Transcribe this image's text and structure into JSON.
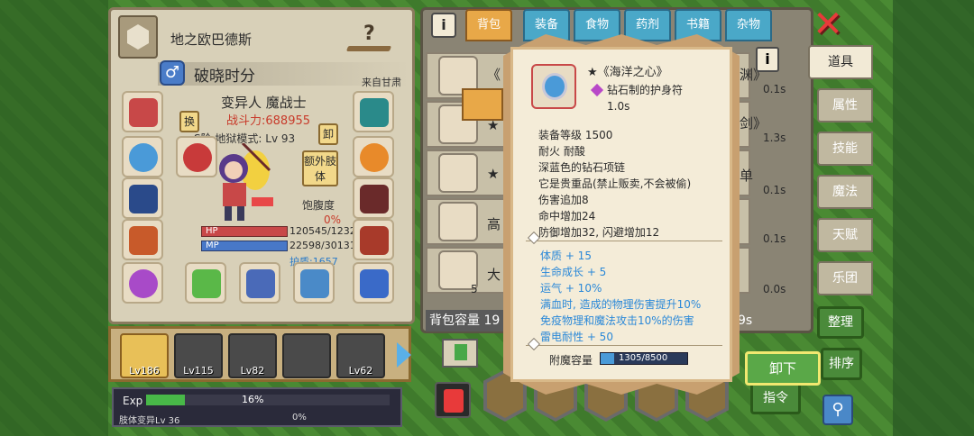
{
  "left": {
    "world_name": "地之欧巴德斯",
    "gender_icon": "♂",
    "player_title": "破晓时分",
    "origin": "来自甘肃",
    "char_class": "变异人 魔战士",
    "combat_power": "战斗力:688955",
    "stage": "S阶 地狱模式: Lv 93",
    "swap_btn": "换",
    "unload_btn": "卸",
    "extra_limb": "额外肢体",
    "hunger_label": "饱腹度",
    "hunger_value": "0%",
    "hp_label": "HP",
    "mp_label": "MP",
    "hp": "120545/1232",
    "mp": "22598/30131",
    "shield": "护盾:1657"
  },
  "party": [
    {
      "level": "Lv186",
      "active": true
    },
    {
      "level": "Lv115",
      "active": false
    },
    {
      "level": "Lv82",
      "active": false
    },
    {
      "level": "",
      "active": false
    },
    {
      "level": "Lv62",
      "active": false
    }
  ],
  "exp": {
    "label": "Exp",
    "percent": "16%",
    "fill_fraction": 0.16,
    "mutation_label": "肢体变异Lv 36",
    "mutation_percent": "0%"
  },
  "bag": {
    "info_icon": "i",
    "tabs": [
      "背包",
      "装备",
      "食物",
      "药剂",
      "书籍",
      "杂物"
    ],
    "rows": [
      {
        "text": "《",
        "text_right": "渊》",
        "time": "0.1s"
      },
      {
        "text": "★",
        "text_right": "剑》",
        "time": "1.3s"
      },
      {
        "text": "★",
        "text_right": "单",
        "time": "0.1s"
      },
      {
        "text": "高",
        "text_right": "",
        "time": "0.1s"
      },
      {
        "text": "大",
        "text_right": "",
        "time": "0.0s"
      }
    ],
    "stack_count": "5",
    "capacity_label": "背包容量 19",
    "capacity_tail": "9s"
  },
  "side_tabs": [
    "道具",
    "属性",
    "技能",
    "魔法",
    "天赋",
    "乐团"
  ],
  "buttons": {
    "sort": "整理",
    "order": "排序",
    "command": "指令",
    "unequip": "卸下",
    "close": "✕",
    "search": "⚲"
  },
  "tooltip": {
    "name": "★《海洋之心》",
    "type": "钻石制的护身符",
    "cooldown": "1.0s",
    "stats": [
      "装备等级 1500",
      "耐火 耐酸",
      "深蓝色的钻石项链",
      "它是贵重品(禁止贩卖,不会被偷)",
      "伤害追加8",
      "命中增加24",
      "防御增加32, 闪避增加12"
    ],
    "bonuses": [
      "体质 + 15",
      "生命成长 + 5",
      "运气 + 10%",
      "满血时, 造成的物理伤害提升10%",
      "免疫物理和魔法攻击10%的伤害",
      "雷电耐性 + 50"
    ],
    "enchant_label": "附魔容量",
    "enchant_value": "1305/8500",
    "enchant_fraction": 0.1535
  },
  "colors": {
    "tab_active": "#e8a848",
    "tab_inactive": "#4aa8c8",
    "bonus_text": "#2a88d8",
    "combat_power": "#c83a2a"
  }
}
